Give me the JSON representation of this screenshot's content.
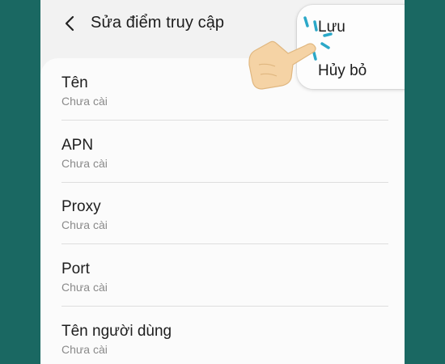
{
  "header": {
    "back_icon": "arrow-left-icon",
    "title": "Sửa điểm truy cập"
  },
  "fields": [
    {
      "label": "Tên",
      "value": "Chưa cài"
    },
    {
      "label": "APN",
      "value": "Chưa cài"
    },
    {
      "label": "Proxy",
      "value": "Chưa cài"
    },
    {
      "label": "Port",
      "value": "Chưa cài"
    },
    {
      "label": "Tên người dùng",
      "value": "Chưa cài"
    }
  ],
  "menu": {
    "save": "Lưu",
    "cancel": "Hủy bỏ"
  },
  "colors": {
    "background": "#1a6862",
    "screen": "#f2f2f2",
    "card": "#fbfbfb",
    "tap_highlight": "#2ba8c8",
    "hand": "#f5d3a5"
  }
}
